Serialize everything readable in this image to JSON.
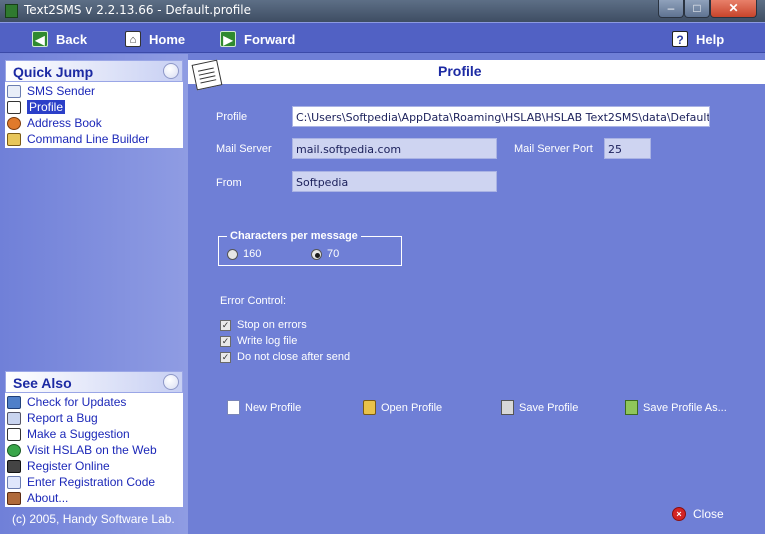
{
  "window": {
    "title": "Text2SMS v 2.2.13.66 - Default.profile",
    "controls": {
      "minimize": "–",
      "maximize": "□",
      "close": "✕"
    }
  },
  "toolbar": {
    "back": "Back",
    "home": "Home",
    "forward": "Forward",
    "help": "Help"
  },
  "sidebar": {
    "quick_jump": {
      "title": "Quick Jump",
      "items": [
        {
          "label": "SMS Sender",
          "icon": "envelope-icon",
          "selected": false
        },
        {
          "label": "Profile",
          "icon": "notepad-icon",
          "selected": true
        },
        {
          "label": "Address Book",
          "icon": "address-book-icon",
          "selected": false
        },
        {
          "label": "Command Line Builder",
          "icon": "command-icon",
          "selected": false
        }
      ]
    },
    "see_also": {
      "title": "See Also",
      "items": [
        {
          "label": "Check for Updates",
          "icon": "monitor-icon"
        },
        {
          "label": "Report a Bug",
          "icon": "bug-icon"
        },
        {
          "label": "Make a Suggestion",
          "icon": "suggestion-icon"
        },
        {
          "label": "Visit HSLAB on the Web",
          "icon": "globe-icon"
        },
        {
          "label": "Register Online",
          "icon": "register-icon"
        },
        {
          "label": "Enter Registration Code",
          "icon": "document-icon"
        },
        {
          "label": "About...",
          "icon": "people-icon"
        }
      ]
    },
    "copyright": "(c) 2005, Handy Software Lab."
  },
  "main": {
    "heading": "Profile",
    "profile_label": "Profile",
    "profile_value": "C:\\Users\\Softpedia\\AppData\\Roaming\\HSLAB\\HSLAB Text2SMS\\data\\Default.profil",
    "mail_server_label": "Mail Server",
    "mail_server_value": "mail.softpedia.com",
    "mail_port_label": "Mail Server Port",
    "mail_port_value": "25",
    "from_label": "From",
    "from_value": "Softpedia",
    "chars_group_title": "Characters per message",
    "chars_options": [
      {
        "label": "160",
        "selected": false
      },
      {
        "label": "70",
        "selected": true
      }
    ],
    "error_control_label": "Error Control:",
    "error_options": [
      {
        "label": "Stop on errors",
        "checked": true
      },
      {
        "label": "Write log file",
        "checked": true
      },
      {
        "label": "Do not close after send",
        "checked": true
      }
    ],
    "actions": {
      "new_profile": "New Profile",
      "open_profile": "Open Profile",
      "save_profile": "Save Profile",
      "save_profile_as": "Save Profile As..."
    },
    "close": "Close"
  },
  "colors": {
    "main_bg": "#6f7fd6",
    "toolbar_bg": "#5161c4",
    "link": "#1c28b8",
    "heading": "#1c2aa3"
  }
}
